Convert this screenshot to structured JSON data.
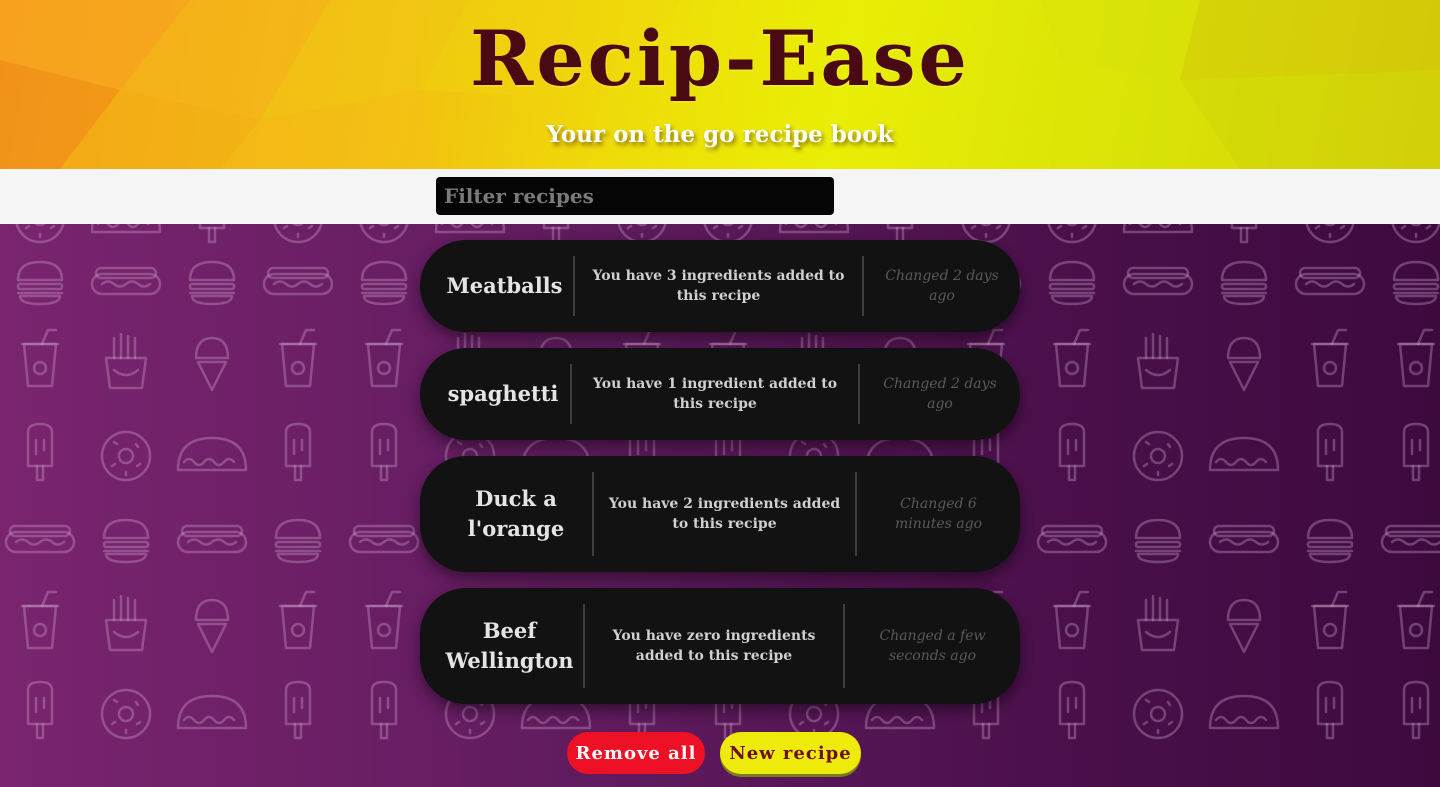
{
  "header": {
    "title": "Recip-Ease",
    "subtitle": "Your on the go recipe book"
  },
  "filter": {
    "placeholder": "Filter recipes",
    "value": ""
  },
  "recipes": [
    {
      "name": "Meatballs",
      "ingredients_text": "You have 3 ingredients added to this recipe",
      "changed_text": "Changed 2 days ago"
    },
    {
      "name": "spaghetti",
      "ingredients_text": "You have 1 ingredient added to this recipe",
      "changed_text": "Changed 2 days ago"
    },
    {
      "name": "Duck a l'orange",
      "ingredients_text": "You have 2 ingredients added to this recipe",
      "changed_text": "Changed 6 minutes ago"
    },
    {
      "name": "Beef Wellington",
      "ingredients_text": "You have zero ingredients added to this recipe",
      "changed_text": "Changed a few seconds ago"
    }
  ],
  "actions": {
    "remove_all_label": "Remove all",
    "new_recipe_label": "New recipe"
  },
  "colors": {
    "title": "#4a0a14",
    "card_bg": "#121212",
    "remove_button": "#ee1024",
    "new_button": "#eeea0a",
    "background": "#5e1a5e"
  },
  "background_pattern_icons": [
    "burger-icon",
    "hotdog-icon",
    "soda-cup-icon",
    "fries-icon",
    "ice-cream-icon",
    "popsicle-icon",
    "donut-icon",
    "taco-icon"
  ]
}
